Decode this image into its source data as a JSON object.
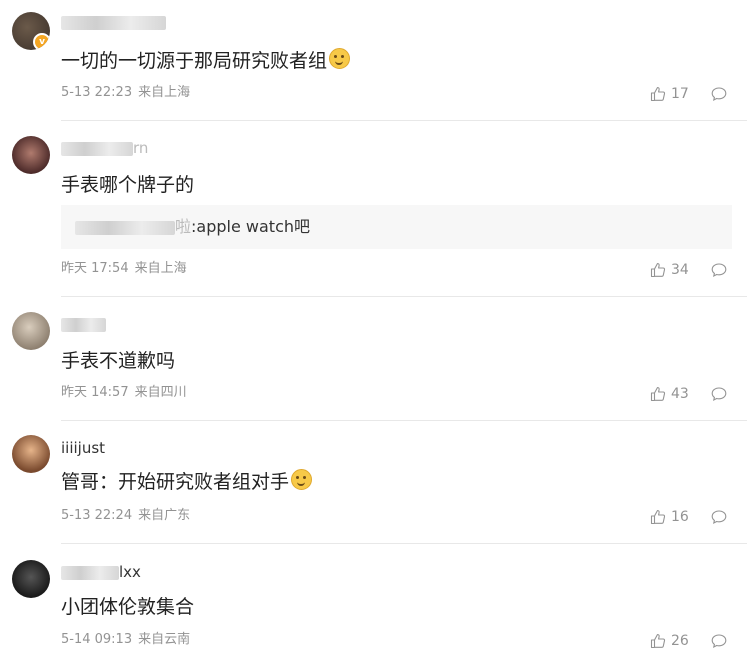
{
  "comments": [
    {
      "text": "一切的一切源于那局研究败者组",
      "has_emoji": true,
      "time": "5-13 22:23",
      "location": "来自上海",
      "likes": "17"
    },
    {
      "username_suffix": "rn",
      "text": "手表哪个牌子的",
      "reply": ":apple watch吧",
      "reply_prefix": "啦",
      "time": "昨天 17:54",
      "location": "来自上海",
      "likes": "34"
    },
    {
      "text": "手表不道歉吗",
      "time": "昨天 14:57",
      "location": "来自四川",
      "likes": "43"
    },
    {
      "username": "iiiijust",
      "text": "管哥：开始研究败者组对手",
      "has_emoji": true,
      "time": "5-13 22:24",
      "location": "来自广东",
      "likes": "16"
    },
    {
      "username_suffix": "lxx",
      "text": "小团体伦敦集合",
      "time": "5-14 09:13",
      "location": "来自云南",
      "likes": "26"
    }
  ],
  "icons": {
    "like": "thumbs-up-icon",
    "comment": "speech-bubble-icon",
    "verified": "verified-badge-icon"
  },
  "colors": {
    "meta_text": "#939393",
    "divider": "#e8e8e8",
    "reply_bg": "#f7f7f7",
    "verified_badge": "#f5a623"
  }
}
